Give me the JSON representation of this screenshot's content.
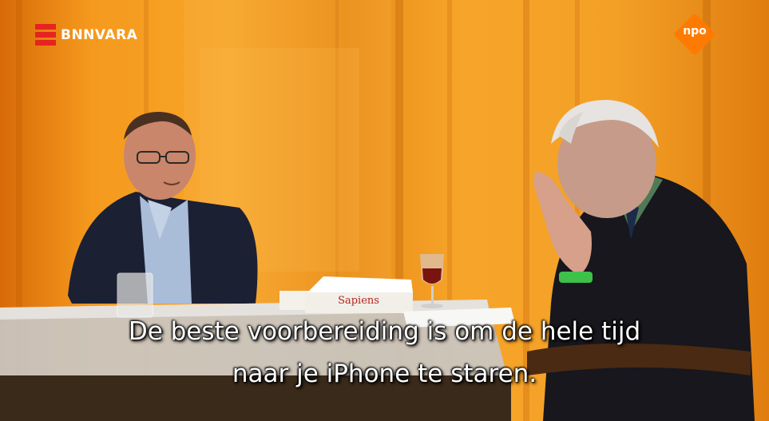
{
  "broadcaster_logo": {
    "text": "BNNVARA",
    "bars_color": "#e52420"
  },
  "channel_logo": {
    "text": "npo",
    "color": "#ff7a00"
  },
  "book": {
    "title": "Sapiens"
  },
  "subtitles": {
    "line1": "De beste voorbereiding is om de hele tijd",
    "line2": "naar je iPhone te staren."
  }
}
